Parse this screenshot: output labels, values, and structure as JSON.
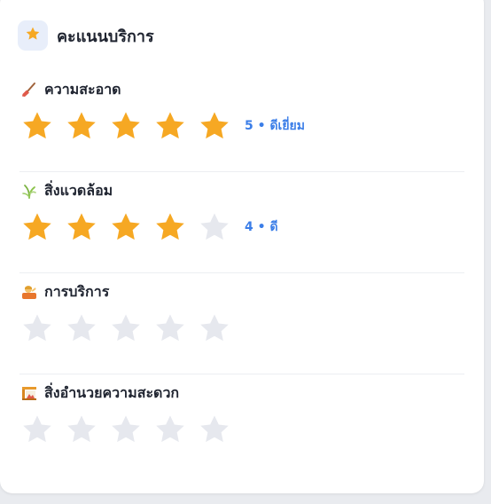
{
  "header": {
    "title": "คะแนนบริการ",
    "icon": "star-icon"
  },
  "colors": {
    "star_filled": "#f6a823",
    "star_empty": "#e6e8ee",
    "rating_text": "#3b7ee8",
    "header_icon_bg": "#e8eefa"
  },
  "categories": [
    {
      "label": "ความสะอาด",
      "icon": "broom-icon",
      "rating": 5,
      "max": 5,
      "rating_text": "5 • ดีเยี่ยม"
    },
    {
      "label": "สิ่งแวดล้อม",
      "icon": "plant-icon",
      "rating": 4,
      "max": 5,
      "rating_text": "4 • ดี"
    },
    {
      "label": "การบริการ",
      "icon": "service-person-icon",
      "rating": 0,
      "max": 5,
      "rating_text": ""
    },
    {
      "label": "สิ่งอำนวยความสะดวก",
      "icon": "amenities-icon",
      "rating": 0,
      "max": 5,
      "rating_text": ""
    }
  ]
}
